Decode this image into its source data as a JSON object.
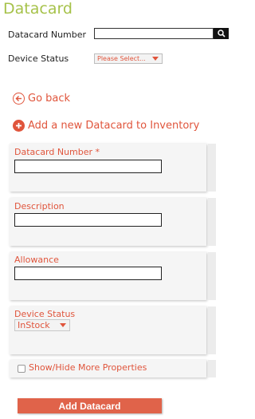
{
  "page": {
    "title": "Datacard"
  },
  "filters": {
    "datacard_number_label": "Datacard Number",
    "datacard_number_value": "",
    "device_status_label": "Device Status",
    "device_status_selected": "Please Select..."
  },
  "links": {
    "go_back": "Go back",
    "add_new": "Add a new Datacard to Inventory"
  },
  "form": {
    "datacard_number_label": "Datacard Number *",
    "datacard_number_value": "",
    "description_label": "Description",
    "description_value": "",
    "allowance_label": "Allowance",
    "allowance_value": "",
    "device_status_label": "Device Status",
    "device_status_selected": "InStock",
    "more_properties_label": "Show/Hide More Properties",
    "more_properties_checked": false,
    "submit_label": "Add Datacard"
  },
  "icons": {
    "search": "search-icon",
    "back": "back-arrow-icon",
    "add": "plus-icon",
    "dropdown": "chevron-down-icon"
  },
  "colors": {
    "title": "#a6c24a",
    "accent": "#e0553c",
    "button": "#e0634a",
    "card_bg": "#f5f5f5"
  }
}
